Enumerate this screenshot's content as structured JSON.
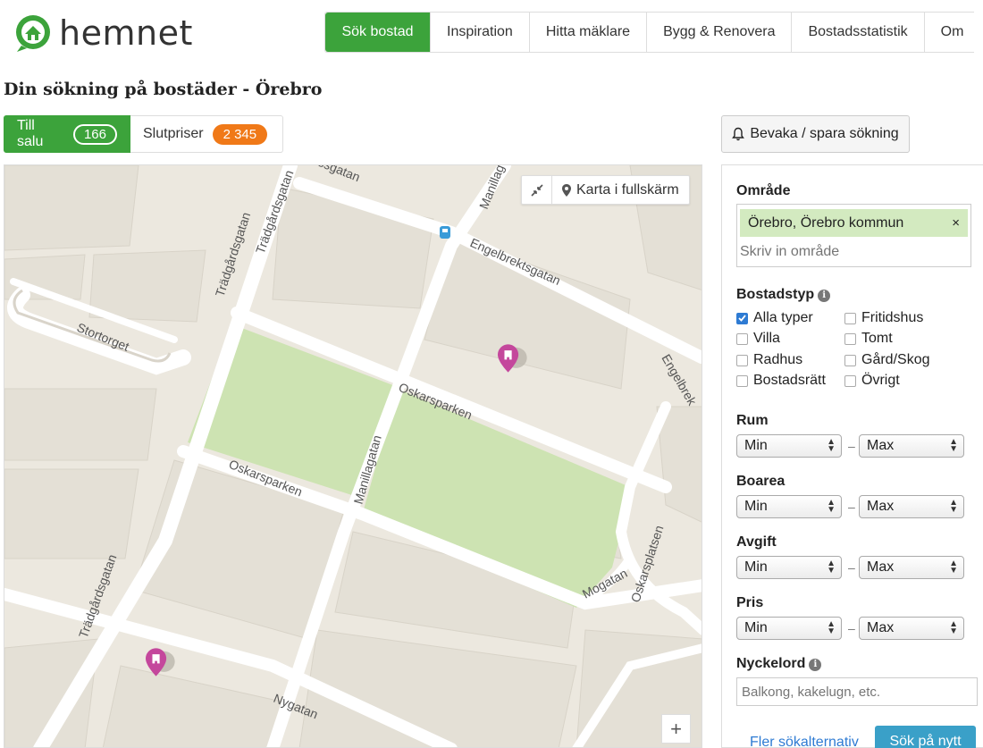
{
  "brand": {
    "name": "hemnet",
    "color": "#3ca33b"
  },
  "nav": {
    "items": [
      {
        "label": "Sök bostad",
        "active": true
      },
      {
        "label": "Inspiration"
      },
      {
        "label": "Hitta mäklare"
      },
      {
        "label": "Bygg & Renovera"
      },
      {
        "label": "Bostadsstatistik"
      },
      {
        "label": "Om"
      }
    ]
  },
  "page": {
    "title": "Din sökning på bostäder - Örebro"
  },
  "tabs": {
    "for_sale": {
      "label": "Till salu",
      "count": "166"
    },
    "sold": {
      "label": "Slutpriser",
      "count": "2 345"
    }
  },
  "watch_button": {
    "label": "Bevaka / spara sökning",
    "icon": "bell-icon"
  },
  "map": {
    "fullscreen_label": "Karta i fullskärm",
    "zoom_in": "+",
    "streets": {
      "tradgardsgatan_1": "Trädgårdsgatan",
      "tradgardsgatan_2": "Trädgårdsgatan",
      "tradgardsgatan_3": "Trädgårdsgatan",
      "storgatan": "ssgatan",
      "manillagatan_top": "Manillag",
      "engelbrekt_1": "Engelbrektsgatan",
      "engelbrekt_2": "Engelbrek",
      "stortorget": "Stortorget",
      "oskarsparken_1": "Oskarsparken",
      "oskarsparken_2": "Oskarsparken",
      "manillagatan": "Manillagatan",
      "mogatan": "Mogatan",
      "oskarsplatsen": "Oskarsplatsen",
      "nygatan": "Nygatan"
    },
    "park_color": "#cde3b2",
    "pin_color": "#c4479c"
  },
  "filters": {
    "area": {
      "label": "Område",
      "selected": "Örebro, Örebro kommun",
      "remove": "×",
      "placeholder": "Skriv in område"
    },
    "type": {
      "label": "Bostadstyp",
      "options": [
        {
          "label": "Alla typer",
          "checked": true
        },
        {
          "label": "Villa",
          "checked": false
        },
        {
          "label": "Radhus",
          "checked": false
        },
        {
          "label": "Bostadsrätt",
          "checked": false
        },
        {
          "label": "Fritidshus",
          "checked": false
        },
        {
          "label": "Tomt",
          "checked": false
        },
        {
          "label": "Gård/Skog",
          "checked": false
        },
        {
          "label": "Övrigt",
          "checked": false
        }
      ]
    },
    "rooms": {
      "label": "Rum",
      "min": "Min",
      "max": "Max"
    },
    "living_area": {
      "label": "Boarea",
      "min": "Min",
      "max": "Max"
    },
    "fee": {
      "label": "Avgift",
      "min": "Min",
      "max": "Max"
    },
    "price": {
      "label": "Pris",
      "min": "Min",
      "max": "Max"
    },
    "separator": "–",
    "keyword": {
      "label": "Nyckelord",
      "placeholder": "Balkong, kakelugn, etc."
    },
    "more_link": "Fler sökalternativ",
    "search_button": "Sök på nytt"
  }
}
